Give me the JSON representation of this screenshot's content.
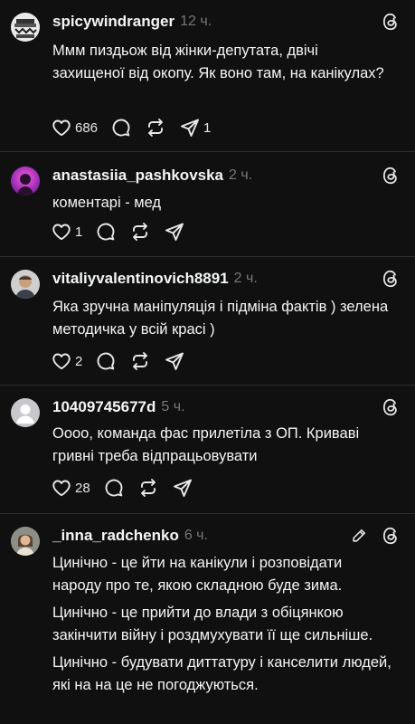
{
  "posts": [
    {
      "username": "spicywindranger",
      "time": "12 ч.",
      "text": [
        "Ммм пиздьож від жінки-депутата, двічі захищеної від окопу. Як воно там, на канікулах?"
      ],
      "likes": "686",
      "replies": "",
      "reposts": "",
      "shares": "1"
    },
    {
      "username": "anastasiia_pashkovska",
      "time": "2 ч.",
      "text": [
        "коментарі - мед"
      ],
      "likes": "1",
      "replies": "",
      "reposts": "",
      "shares": ""
    },
    {
      "username": "vitaliyvalentinovich8891",
      "time": "2 ч.",
      "text": [
        "Яка зручна маніпуляція і підміна фактів ) зелена методичка у всій красі )"
      ],
      "likes": "2",
      "replies": "",
      "reposts": "",
      "shares": ""
    },
    {
      "username": "10409745677d",
      "time": "5 ч.",
      "text": [
        "Оооо, команда фас прилетіла з ОП. Криваві гривні треба відпрацьовувати"
      ],
      "likes": "28",
      "replies": "",
      "reposts": "",
      "shares": ""
    },
    {
      "username": "_inna_radchenko",
      "time": "6 ч.",
      "text": [
        "Цинічно - це йти на канікули і розповідати народу про те, якою складною буде зима.",
        "Цинічно - це прийти до влади з обіцянкою закінчити війну і роздмухувати її ще сильніше.",
        "Цинічно - будувати диттатуру і канселити людей, які на на це не погоджуються."
      ],
      "likes": "",
      "replies": "",
      "reposts": "",
      "shares": ""
    }
  ],
  "icons": {
    "like": "heart-icon",
    "reply": "comment-icon",
    "repost": "repost-icon",
    "share": "share-icon",
    "app": "threads-logo-icon",
    "edit": "pencil-icon"
  },
  "colors": {
    "background": "#101010",
    "text": "#f3f5f7",
    "muted": "#777777",
    "divider": "#2d2d2d"
  }
}
